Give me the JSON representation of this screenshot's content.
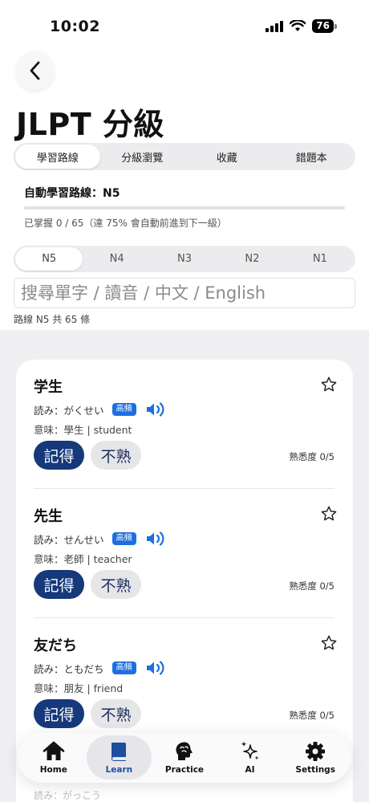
{
  "status": {
    "time": "10:02",
    "battery": "76"
  },
  "page": {
    "title": "JLPT 分級"
  },
  "main_tabs": [
    {
      "label": "學習路線",
      "active": true
    },
    {
      "label": "分級瀏覽",
      "active": false
    },
    {
      "label": "收藏",
      "active": false
    },
    {
      "label": "錯題本",
      "active": false
    }
  ],
  "route": {
    "label": "自動學習路線：N5",
    "progress": 0.0,
    "note": "已掌握 0 / 65（達 75% 會自動前進到下一級）"
  },
  "levels": [
    {
      "label": "N5",
      "active": true
    },
    {
      "label": "N4",
      "active": false
    },
    {
      "label": "N3",
      "active": false
    },
    {
      "label": "N2",
      "active": false
    },
    {
      "label": "N1",
      "active": false
    }
  ],
  "search": {
    "placeholder": "搜尋單字 / 讀音 / 中文 / English",
    "value": ""
  },
  "count_label": "路線 N5 共 65 條",
  "words": [
    {
      "word": "学生",
      "reading": "読み：がくせい",
      "badge": "高頻",
      "meaning": "意味：學生 | student",
      "remember": "記得",
      "unfamiliar": "不熟",
      "familiarity": "熟悉度 0/5"
    },
    {
      "word": "先生",
      "reading": "読み：せんせい",
      "badge": "高頻",
      "meaning": "意味：老師 | teacher",
      "remember": "記得",
      "unfamiliar": "不熟",
      "familiarity": "熟悉度 0/5"
    },
    {
      "word": "友だち",
      "reading": "読み：ともだち",
      "badge": "高頻",
      "meaning": "意味：朋友 | friend",
      "remember": "記得",
      "unfamiliar": "不熟",
      "familiarity": "熟悉度 0/5"
    }
  ],
  "peek": "読み：がっこう",
  "tab_bar": [
    {
      "label": "Home",
      "icon": "home-icon",
      "active": false
    },
    {
      "label": "Learn",
      "icon": "book-icon",
      "active": true
    },
    {
      "label": "Practice",
      "icon": "brain-icon",
      "active": false
    },
    {
      "label": "AI",
      "icon": "sparkles-icon",
      "active": false
    },
    {
      "label": "Settings",
      "icon": "gear-icon",
      "active": false
    }
  ],
  "colors": {
    "primary": "#15397a",
    "accent": "#1d6fe0",
    "background": "#efeff2"
  }
}
